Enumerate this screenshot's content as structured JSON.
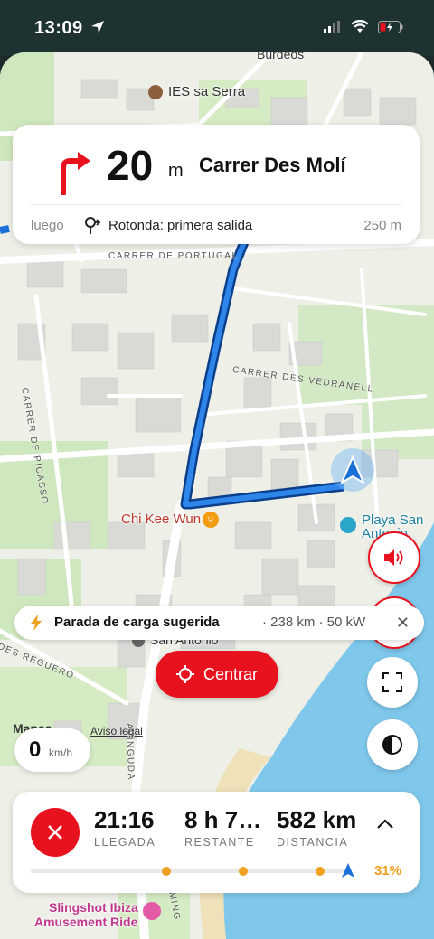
{
  "status_bar": {
    "time": "13:09"
  },
  "map": {
    "pois": {
      "burdeos": "Burdeos",
      "ies": "IES sa Serra",
      "restaurant": "Chi Kee Wun",
      "beach": "Playa San Antonio",
      "beach_line1": "Playa San",
      "beach_line2": "Antonio",
      "san_antonio": "San Antonio",
      "slingshot_line1": "Slingshot Ibiza",
      "slingshot_line2": "Amusement Ride"
    },
    "streets": {
      "portugal": "CARRER DE PORTUGAL",
      "picasso": "CARRER DE PICASSO",
      "vedranell": "CARRER DES VEDRANELL",
      "reguero": "DES REGUERO",
      "avinguda": "AVINGUDA",
      "eming": "EMING"
    },
    "attribution": {
      "brand": "Mapas",
      "legal": "Aviso legal"
    }
  },
  "instruction": {
    "distance": "20",
    "unit": "m",
    "street": "Carrer Des Molí",
    "then_label": "luego",
    "next_text": "Rotonda: primera salida",
    "next_distance": "250 m"
  },
  "charge_banner": {
    "title": "Parada de carga sugerida",
    "meta": "· 238 km  · 50 kW"
  },
  "center_button": {
    "label": "Centrar"
  },
  "speed": {
    "value": "0",
    "unit": "km/h"
  },
  "trip": {
    "arrival": {
      "value": "21:16",
      "label": "LLEGADA"
    },
    "remaining": {
      "value": "8 h 7…",
      "label": "RESTANTE"
    },
    "distance": {
      "value": "582 km",
      "label": "DISTANCIA"
    },
    "battery_percent": "31%"
  },
  "colors": {
    "accent_red": "#e8121f",
    "route_blue": "#1a6fd8",
    "charge_orange": "#f0a020"
  }
}
